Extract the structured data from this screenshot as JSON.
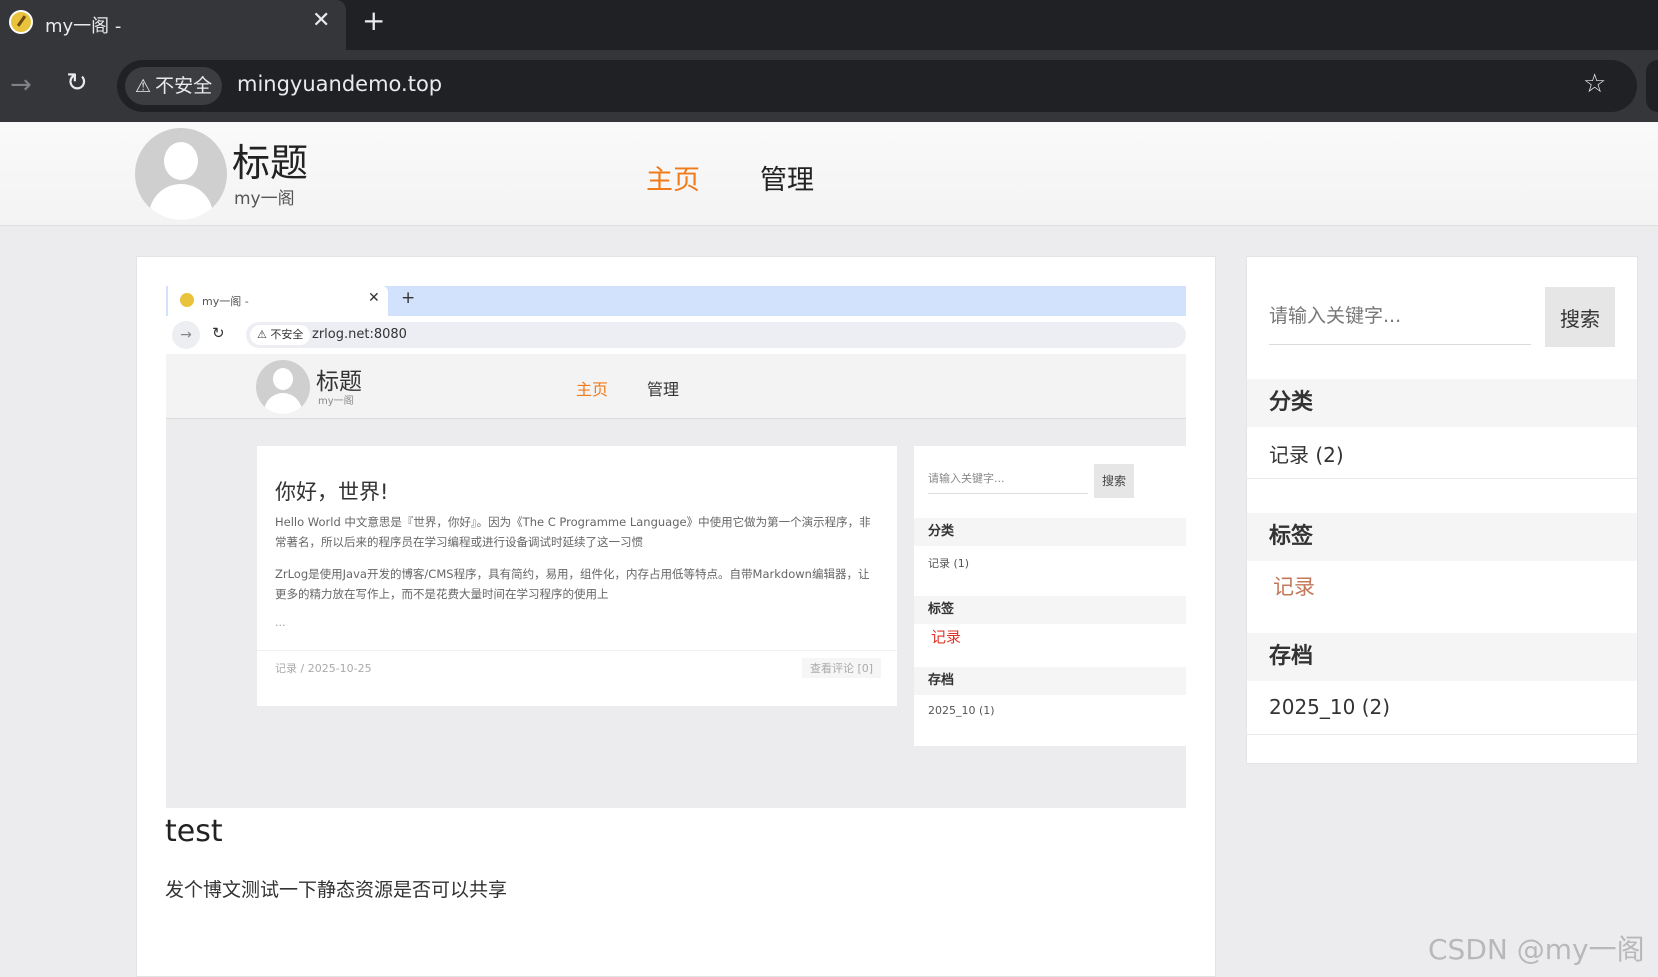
{
  "browser": {
    "tab_title": "my一阁 -",
    "close_glyph": "✕",
    "newtab_glyph": "+",
    "security_label": "不安全",
    "url": "mingyuandemo.top"
  },
  "site": {
    "brand_title": "标题",
    "brand_subtitle": "my一阁",
    "nav": {
      "home": "主页",
      "admin": "管理"
    }
  },
  "post_image": {
    "tab_title": "my一阁 -",
    "security_label": "不安全",
    "url": "zrlog.net:8080",
    "brand_title": "标题",
    "brand_subtitle": "my一阁",
    "nav_home": "主页",
    "nav_admin": "管理",
    "post_title": "你好，世界!",
    "para1": "Hello World 中文意思是『世界，你好』。因为《The C Programme Language》中使用它做为第一个演示程序，非常著名，所以后来的程序员在学习编程或进行设备调试时延续了这一习惯",
    "para2": "ZrLog是使用Java开发的博客/CMS程序，具有简约，易用，组件化，内存占用低等特点。自带Markdown编辑器，让更多的精力放在写作上，而不是花费大量时间在学习程序的使用上",
    "ellipsis": "...",
    "meta_left": "记录 / 2025-10-25",
    "meta_right": "查看评论 [0]",
    "search_placeholder": "请输入关键字...",
    "search_button": "搜索",
    "categories_heading": "分类",
    "category_item": "记录 (1)",
    "tags_heading": "标签",
    "tag_item": "记录",
    "archive_heading": "存档",
    "archive_item": "2025_10 (1)"
  },
  "post": {
    "title": "test",
    "text": "发个博文测试一下静态资源是否可以共享"
  },
  "sidebar": {
    "search_placeholder": "请输入关键字...",
    "search_button": "搜索",
    "categories_heading": "分类",
    "categories": [
      {
        "label": "记录 (2)"
      }
    ],
    "tags_heading": "标签",
    "tags": [
      {
        "label": "记录"
      }
    ],
    "archive_heading": "存档",
    "archives": [
      {
        "label": "2025_10 (2)"
      }
    ]
  },
  "watermark": "CSDN @my一阁",
  "colors": {
    "accent": "#f07b1b",
    "tag": "#c4785a"
  }
}
